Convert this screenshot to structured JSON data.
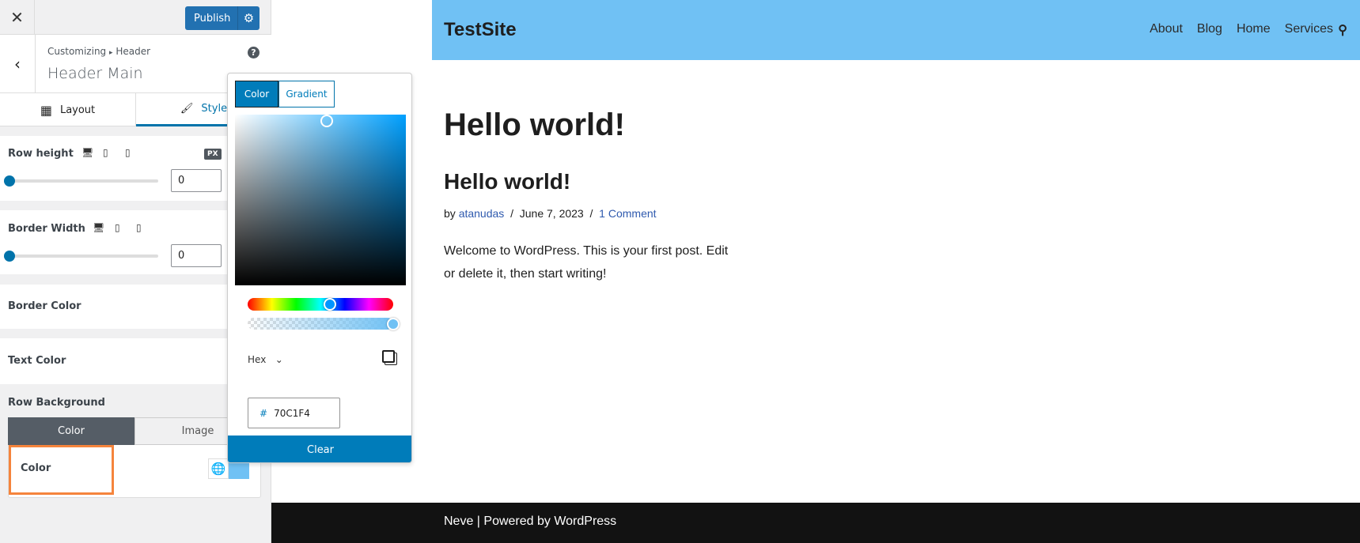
{
  "panel": {
    "close_icon": "close-icon",
    "publish_label": "Publish",
    "breadcrumb": {
      "root": "Customizing",
      "separator": "▸",
      "current": "Header"
    },
    "title": "Header Main",
    "help": "?",
    "tabs": [
      {
        "label": "Layout",
        "icon": "layout-icon"
      },
      {
        "label": "Style",
        "icon": "brush-icon",
        "active": true
      }
    ],
    "row_height": {
      "label": "Row height",
      "unit": "PX",
      "value": "0",
      "slider_fraction": 0
    },
    "border_width": {
      "label": "Border Width",
      "value": "0",
      "slider_fraction": 0
    },
    "border_color": {
      "label": "Border Color"
    },
    "text_color": {
      "label": "Text Color"
    },
    "row_background": {
      "label": "Row Background",
      "tabs": [
        "Color",
        "Image"
      ],
      "active_tab": "Color",
      "color_label": "Color",
      "swatch_color": "#70C1F4"
    }
  },
  "picker": {
    "tabs": [
      "Color",
      "Gradient"
    ],
    "active_tab": "Color",
    "format": "Hex",
    "hash": "#",
    "hex_value": "70C1F4",
    "hue_deg": 203,
    "alpha": 1,
    "clear_label": "Clear"
  },
  "site": {
    "title": "TestSite",
    "header_bg": "#70C1F4",
    "nav": [
      "About",
      "Blog",
      "Home",
      "Services"
    ],
    "post_title": "Hello world!",
    "entry_title": "Hello world!",
    "meta": {
      "by": "by",
      "author": "atanudas",
      "sep": "/",
      "date": "June 7, 2023",
      "comments": "1 Comment"
    },
    "excerpt": "Welcome to WordPress. This is your first post. Edit or delete it, then start writing!",
    "footer": "Neve | Powered by WordPress"
  }
}
